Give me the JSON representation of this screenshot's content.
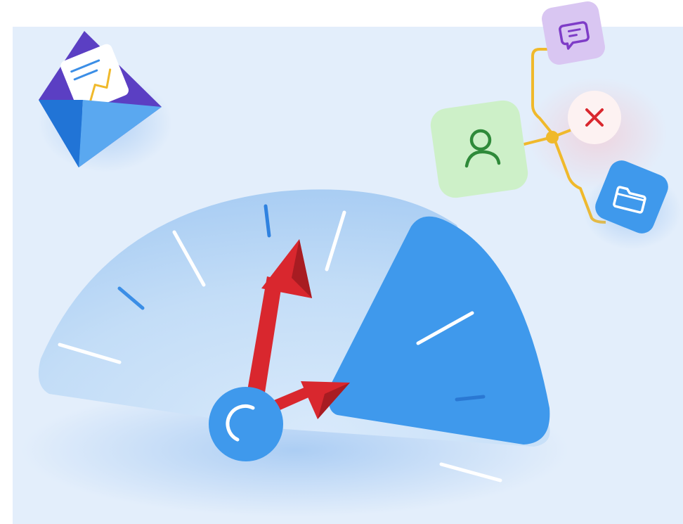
{
  "illustration": {
    "colors": {
      "background_panel": "#e3eefb",
      "dial_light": "#b9d7f6",
      "dial_fill": "#3f99ec",
      "needle_red": "#d9272e",
      "needle_dark": "#a81c22",
      "hub": "#3f99ec",
      "connector_line": "#f0b92b",
      "user_tile": "#cdf0c8",
      "user_icon": "#2f8a3a",
      "chat_tile": "#d9c6f2",
      "chat_icon": "#7e3cc7",
      "close_circle": "#fdf2f2",
      "close_icon": "#d9272e",
      "folder_tile": "#3f99ec",
      "envelope_front": "#2b86e6",
      "envelope_flap": "#5aa8f0",
      "envelope_inner": "#5b3fc3",
      "letter_paper": "#ffffff"
    },
    "icons": [
      "envelope-with-chart-icon",
      "chat-bubble-icon",
      "user-icon",
      "close-icon",
      "folder-icon",
      "speedometer-gauge",
      "gauge-needle-icon"
    ],
    "gauge": {
      "needle_count": 2,
      "highlighted_segment": "right"
    }
  }
}
